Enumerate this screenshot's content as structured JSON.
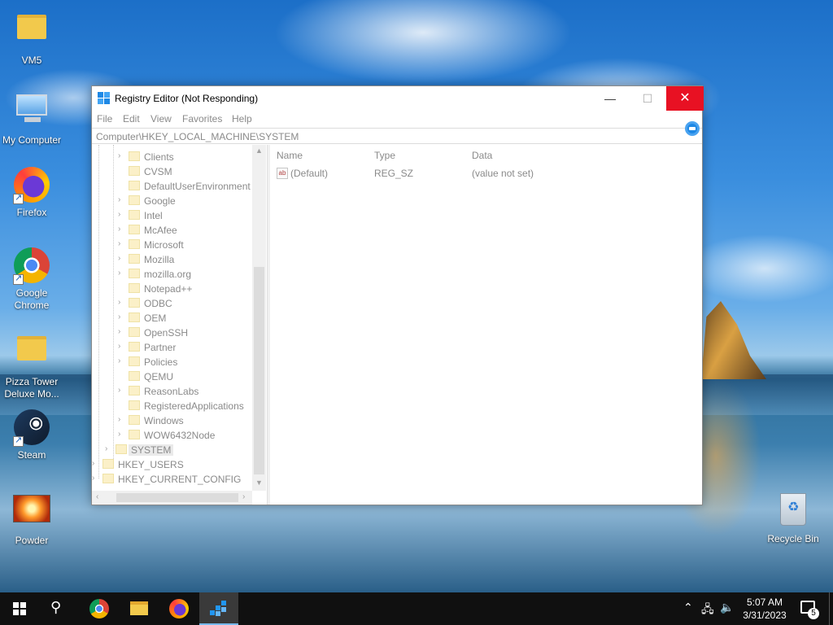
{
  "desktop": {
    "icons": [
      {
        "label": "VM5",
        "icon": "user-folder-icon"
      },
      {
        "label": "My Computer",
        "icon": "computer-icon"
      },
      {
        "label": "Firefox",
        "icon": "firefox-icon"
      },
      {
        "label": "Google Chrome",
        "icon": "chrome-icon"
      },
      {
        "label": "Pizza Tower Deluxe Mo...",
        "icon": "folder-icon"
      },
      {
        "label": "Steam",
        "icon": "steam-icon"
      },
      {
        "label": "Powder",
        "icon": "powder-icon"
      },
      {
        "label": "Recycle Bin",
        "icon": "recycle-bin-icon"
      }
    ]
  },
  "window": {
    "title": "Registry Editor (Not Responding)",
    "minimize_glyph": "—",
    "maximize_glyph": "☐",
    "close_glyph": "✕",
    "menu": [
      "File",
      "Edit",
      "View",
      "Favorites",
      "Help"
    ],
    "address": "Computer\\HKEY_LOCAL_MACHINE\\SYSTEM"
  },
  "tree": {
    "items": [
      {
        "label": "Clients",
        "level": 2,
        "has_children": true
      },
      {
        "label": "CVSM",
        "level": 2,
        "has_children": false
      },
      {
        "label": "DefaultUserEnvironment",
        "level": 2,
        "has_children": false
      },
      {
        "label": "Google",
        "level": 2,
        "has_children": true
      },
      {
        "label": "Intel",
        "level": 2,
        "has_children": true
      },
      {
        "label": "McAfee",
        "level": 2,
        "has_children": true
      },
      {
        "label": "Microsoft",
        "level": 2,
        "has_children": true
      },
      {
        "label": "Mozilla",
        "level": 2,
        "has_children": true
      },
      {
        "label": "mozilla.org",
        "level": 2,
        "has_children": true
      },
      {
        "label": "Notepad++",
        "level": 2,
        "has_children": false
      },
      {
        "label": "ODBC",
        "level": 2,
        "has_children": true
      },
      {
        "label": "OEM",
        "level": 2,
        "has_children": true
      },
      {
        "label": "OpenSSH",
        "level": 2,
        "has_children": true
      },
      {
        "label": "Partner",
        "level": 2,
        "has_children": true
      },
      {
        "label": "Policies",
        "level": 2,
        "has_children": true
      },
      {
        "label": "QEMU",
        "level": 2,
        "has_children": false
      },
      {
        "label": "ReasonLabs",
        "level": 2,
        "has_children": true
      },
      {
        "label": "RegisteredApplications",
        "level": 2,
        "has_children": false
      },
      {
        "label": "Windows",
        "level": 2,
        "has_children": true
      },
      {
        "label": "WOW6432Node",
        "level": 2,
        "has_children": true
      },
      {
        "label": "SYSTEM",
        "level": 1,
        "has_children": true,
        "selected": true
      },
      {
        "label": "HKEY_USERS",
        "level": 0,
        "has_children": true
      },
      {
        "label": "HKEY_CURRENT_CONFIG",
        "level": 0,
        "has_children": true
      }
    ]
  },
  "values": {
    "columns": [
      "Name",
      "Type",
      "Data"
    ],
    "rows": [
      {
        "name": "(Default)",
        "type": "REG_SZ",
        "data": "(value not set)",
        "icon": "string-value-icon"
      }
    ]
  },
  "taskbar": {
    "items": [
      "start-button",
      "search-button",
      "chrome",
      "file-explorer",
      "firefox",
      "registry-editor"
    ],
    "active": "registry-editor",
    "time": "5:07 AM",
    "date": "3/31/2023",
    "notification_count": "5"
  }
}
